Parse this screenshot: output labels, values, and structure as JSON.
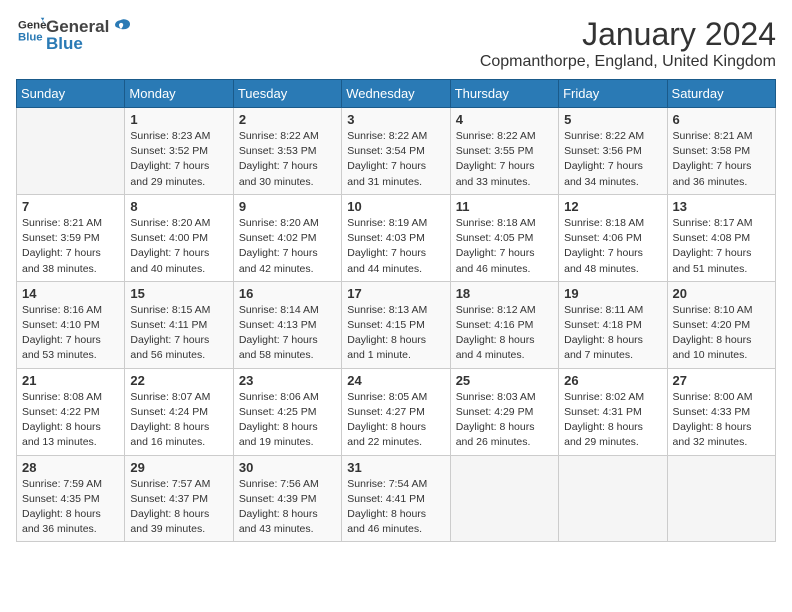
{
  "header": {
    "logo_general": "General",
    "logo_blue": "Blue",
    "month": "January 2024",
    "location": "Copmanthorpe, England, United Kingdom"
  },
  "days_of_week": [
    "Sunday",
    "Monday",
    "Tuesday",
    "Wednesday",
    "Thursday",
    "Friday",
    "Saturday"
  ],
  "weeks": [
    [
      {
        "day": "",
        "info": ""
      },
      {
        "day": "1",
        "info": "Sunrise: 8:23 AM\nSunset: 3:52 PM\nDaylight: 7 hours and 29 minutes."
      },
      {
        "day": "2",
        "info": "Sunrise: 8:22 AM\nSunset: 3:53 PM\nDaylight: 7 hours and 30 minutes."
      },
      {
        "day": "3",
        "info": "Sunrise: 8:22 AM\nSunset: 3:54 PM\nDaylight: 7 hours and 31 minutes."
      },
      {
        "day": "4",
        "info": "Sunrise: 8:22 AM\nSunset: 3:55 PM\nDaylight: 7 hours and 33 minutes."
      },
      {
        "day": "5",
        "info": "Sunrise: 8:22 AM\nSunset: 3:56 PM\nDaylight: 7 hours and 34 minutes."
      },
      {
        "day": "6",
        "info": "Sunrise: 8:21 AM\nSunset: 3:58 PM\nDaylight: 7 hours and 36 minutes."
      }
    ],
    [
      {
        "day": "7",
        "info": "Sunrise: 8:21 AM\nSunset: 3:59 PM\nDaylight: 7 hours and 38 minutes."
      },
      {
        "day": "8",
        "info": "Sunrise: 8:20 AM\nSunset: 4:00 PM\nDaylight: 7 hours and 40 minutes."
      },
      {
        "day": "9",
        "info": "Sunrise: 8:20 AM\nSunset: 4:02 PM\nDaylight: 7 hours and 42 minutes."
      },
      {
        "day": "10",
        "info": "Sunrise: 8:19 AM\nSunset: 4:03 PM\nDaylight: 7 hours and 44 minutes."
      },
      {
        "day": "11",
        "info": "Sunrise: 8:18 AM\nSunset: 4:05 PM\nDaylight: 7 hours and 46 minutes."
      },
      {
        "day": "12",
        "info": "Sunrise: 8:18 AM\nSunset: 4:06 PM\nDaylight: 7 hours and 48 minutes."
      },
      {
        "day": "13",
        "info": "Sunrise: 8:17 AM\nSunset: 4:08 PM\nDaylight: 7 hours and 51 minutes."
      }
    ],
    [
      {
        "day": "14",
        "info": "Sunrise: 8:16 AM\nSunset: 4:10 PM\nDaylight: 7 hours and 53 minutes."
      },
      {
        "day": "15",
        "info": "Sunrise: 8:15 AM\nSunset: 4:11 PM\nDaylight: 7 hours and 56 minutes."
      },
      {
        "day": "16",
        "info": "Sunrise: 8:14 AM\nSunset: 4:13 PM\nDaylight: 7 hours and 58 minutes."
      },
      {
        "day": "17",
        "info": "Sunrise: 8:13 AM\nSunset: 4:15 PM\nDaylight: 8 hours and 1 minute."
      },
      {
        "day": "18",
        "info": "Sunrise: 8:12 AM\nSunset: 4:16 PM\nDaylight: 8 hours and 4 minutes."
      },
      {
        "day": "19",
        "info": "Sunrise: 8:11 AM\nSunset: 4:18 PM\nDaylight: 8 hours and 7 minutes."
      },
      {
        "day": "20",
        "info": "Sunrise: 8:10 AM\nSunset: 4:20 PM\nDaylight: 8 hours and 10 minutes."
      }
    ],
    [
      {
        "day": "21",
        "info": "Sunrise: 8:08 AM\nSunset: 4:22 PM\nDaylight: 8 hours and 13 minutes."
      },
      {
        "day": "22",
        "info": "Sunrise: 8:07 AM\nSunset: 4:24 PM\nDaylight: 8 hours and 16 minutes."
      },
      {
        "day": "23",
        "info": "Sunrise: 8:06 AM\nSunset: 4:25 PM\nDaylight: 8 hours and 19 minutes."
      },
      {
        "day": "24",
        "info": "Sunrise: 8:05 AM\nSunset: 4:27 PM\nDaylight: 8 hours and 22 minutes."
      },
      {
        "day": "25",
        "info": "Sunrise: 8:03 AM\nSunset: 4:29 PM\nDaylight: 8 hours and 26 minutes."
      },
      {
        "day": "26",
        "info": "Sunrise: 8:02 AM\nSunset: 4:31 PM\nDaylight: 8 hours and 29 minutes."
      },
      {
        "day": "27",
        "info": "Sunrise: 8:00 AM\nSunset: 4:33 PM\nDaylight: 8 hours and 32 minutes."
      }
    ],
    [
      {
        "day": "28",
        "info": "Sunrise: 7:59 AM\nSunset: 4:35 PM\nDaylight: 8 hours and 36 minutes."
      },
      {
        "day": "29",
        "info": "Sunrise: 7:57 AM\nSunset: 4:37 PM\nDaylight: 8 hours and 39 minutes."
      },
      {
        "day": "30",
        "info": "Sunrise: 7:56 AM\nSunset: 4:39 PM\nDaylight: 8 hours and 43 minutes."
      },
      {
        "day": "31",
        "info": "Sunrise: 7:54 AM\nSunset: 4:41 PM\nDaylight: 8 hours and 46 minutes."
      },
      {
        "day": "",
        "info": ""
      },
      {
        "day": "",
        "info": ""
      },
      {
        "day": "",
        "info": ""
      }
    ]
  ]
}
